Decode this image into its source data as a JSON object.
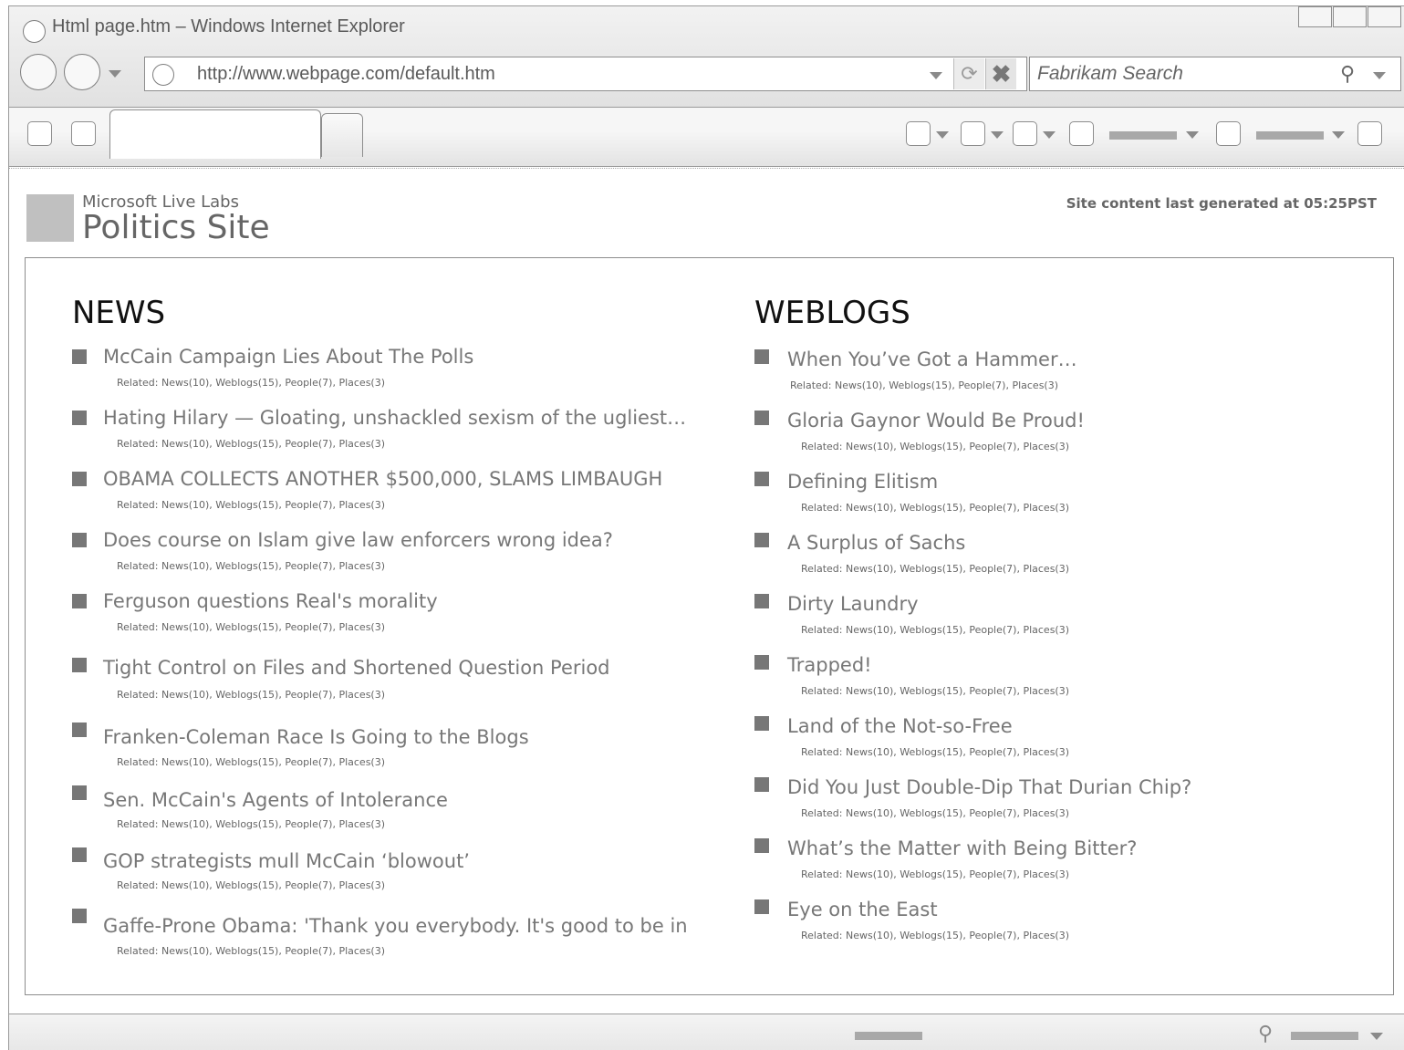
{
  "window": {
    "title": "Html page.htm – Windows Internet Explorer",
    "address": "http://www.webpage.com/default.htm",
    "search_placeholder": "Fabrikam Search"
  },
  "icons": {
    "refresh": "refresh-icon",
    "stop": "stop-icon",
    "search": "search-icon",
    "zoom": "zoom-icon"
  },
  "site": {
    "org": "Microsoft Live Labs",
    "title": "Politics Site",
    "generated": "Site content last generated at 05:25PST"
  },
  "news": {
    "heading": "NEWS",
    "items": [
      {
        "title": "McCain Campaign Lies About The Polls",
        "related": "Related: News(10), Weblogs(15), People(7), Places(3)"
      },
      {
        "title": "Hating Hilary — Gloating, unshackled sexism of the ugliest…",
        "related": "Related: News(10), Weblogs(15), People(7), Places(3)"
      },
      {
        "title": "OBAMA COLLECTS ANOTHER $500,000, SLAMS LIMBAUGH",
        "related": "Related: News(10), Weblogs(15), People(7), Places(3)"
      },
      {
        "title": "Does course on Islam give law enforcers wrong idea?",
        "related": "Related: News(10), Weblogs(15), People(7), Places(3)"
      },
      {
        "title": "Ferguson questions Real's morality",
        "related": "Related: News(10), Weblogs(15), People(7), Places(3)"
      },
      {
        "title": "Tight Control on Files and Shortened Question Period",
        "related": "Related: News(10), Weblogs(15), People(7), Places(3)"
      },
      {
        "title": "Franken-Coleman Race Is Going to the Blogs",
        "related": "Related: News(10), Weblogs(15), People(7), Places(3)"
      },
      {
        "title": "Sen. McCain's Agents of Intolerance",
        "related": "Related: News(10), Weblogs(15), People(7), Places(3)"
      },
      {
        "title": "GOP strategists mull McCain ‘blowout’",
        "related": "Related: News(10), Weblogs(15), People(7), Places(3)"
      },
      {
        "title": "Gaffe-Prone Obama: 'Thank you everybody.  It's good to be in",
        "related": "Related: News(10), Weblogs(15), People(7), Places(3)"
      }
    ]
  },
  "weblogs": {
    "heading": "WEBLOGS",
    "items": [
      {
        "title": "When You’ve Got a Hammer…",
        "related": "Related: News(10), Weblogs(15), People(7), Places(3)"
      },
      {
        "title": "Gloria Gaynor Would Be Proud!",
        "related": "Related: News(10), Weblogs(15), People(7), Places(3)"
      },
      {
        "title": "Defining Elitism",
        "related": "Related: News(10), Weblogs(15), People(7), Places(3)"
      },
      {
        "title": "A Surplus of Sachs",
        "related": "Related: News(10), Weblogs(15), People(7), Places(3)"
      },
      {
        "title": "Dirty Laundry",
        "related": "Related: News(10), Weblogs(15), People(7), Places(3)"
      },
      {
        "title": "Trapped!",
        "related": "Related: News(10), Weblogs(15), People(7), Places(3)"
      },
      {
        "title": "Land of the Not-so-Free",
        "related": "Related: News(10), Weblogs(15), People(7), Places(3)"
      },
      {
        "title": "Did You Just Double-Dip That Durian Chip?",
        "related": "Related: News(10), Weblogs(15), People(7), Places(3)"
      },
      {
        "title": "What’s the Matter with Being Bitter?",
        "related": "Related: News(10), Weblogs(15), People(7), Places(3)"
      },
      {
        "title": "Eye on the East",
        "related": "Related: News(10), Weblogs(15), People(7), Places(3)"
      }
    ]
  }
}
